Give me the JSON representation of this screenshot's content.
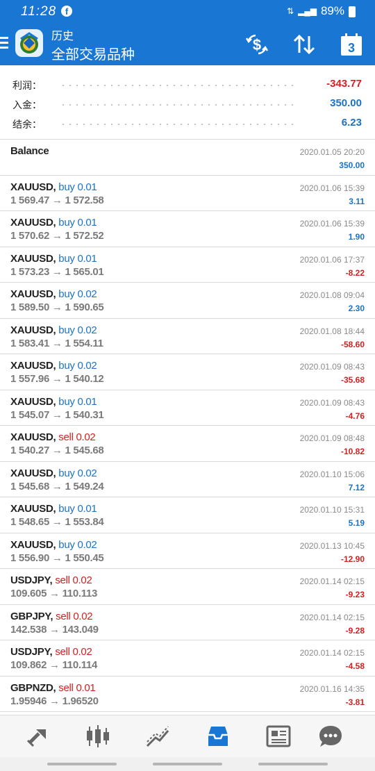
{
  "status_bar": {
    "time": "11:28",
    "battery": "89%",
    "network": "4G"
  },
  "app_bar": {
    "title_small": "历史",
    "title_large": "全部交易品种",
    "calendar_day": "3",
    "icons": [
      "menu-icon",
      "app-logo",
      "currency-exchange-icon",
      "sort-icon",
      "calendar-icon"
    ]
  },
  "summary": [
    {
      "label": "利润：",
      "value": "-343.77",
      "sign": "negative"
    },
    {
      "label": "入金：",
      "value": "350.00",
      "sign": "positive"
    },
    {
      "label": "结余：",
      "value": "6.23",
      "sign": "positive"
    }
  ],
  "deals": [
    {
      "symbol": "Balance",
      "side": "",
      "volume": "",
      "open_price": "",
      "close_price": "",
      "time": "2020.01.05 20:20",
      "profit": "350.00",
      "sign": "positive"
    },
    {
      "symbol": "XAUUSD,",
      "side": "buy",
      "volume": "0.01",
      "open_price": "1 569.47",
      "close_price": "1 572.58",
      "time": "2020.01.06 15:39",
      "profit": "3.11",
      "sign": "positive"
    },
    {
      "symbol": "XAUUSD,",
      "side": "buy",
      "volume": "0.01",
      "open_price": "1 570.62",
      "close_price": "1 572.52",
      "time": "2020.01.06 15:39",
      "profit": "1.90",
      "sign": "positive"
    },
    {
      "symbol": "XAUUSD,",
      "side": "buy",
      "volume": "0.01",
      "open_price": "1 573.23",
      "close_price": "1 565.01",
      "time": "2020.01.06 17:37",
      "profit": "-8.22",
      "sign": "negative"
    },
    {
      "symbol": "XAUUSD,",
      "side": "buy",
      "volume": "0.02",
      "open_price": "1 589.50",
      "close_price": "1 590.65",
      "time": "2020.01.08 09:04",
      "profit": "2.30",
      "sign": "positive"
    },
    {
      "symbol": "XAUUSD,",
      "side": "buy",
      "volume": "0.02",
      "open_price": "1 583.41",
      "close_price": "1 554.11",
      "time": "2020.01.08 18:44",
      "profit": "-58.60",
      "sign": "negative"
    },
    {
      "symbol": "XAUUSD,",
      "side": "buy",
      "volume": "0.02",
      "open_price": "1 557.96",
      "close_price": "1 540.12",
      "time": "2020.01.09 08:43",
      "profit": "-35.68",
      "sign": "negative"
    },
    {
      "symbol": "XAUUSD,",
      "side": "buy",
      "volume": "0.01",
      "open_price": "1 545.07",
      "close_price": "1 540.31",
      "time": "2020.01.09 08:43",
      "profit": "-4.76",
      "sign": "negative"
    },
    {
      "symbol": "XAUUSD,",
      "side": "sell",
      "volume": "0.02",
      "open_price": "1 540.27",
      "close_price": "1 545.68",
      "time": "2020.01.09 08:48",
      "profit": "-10.82",
      "sign": "negative"
    },
    {
      "symbol": "XAUUSD,",
      "side": "buy",
      "volume": "0.02",
      "open_price": "1 545.68",
      "close_price": "1 549.24",
      "time": "2020.01.10 15:06",
      "profit": "7.12",
      "sign": "positive"
    },
    {
      "symbol": "XAUUSD,",
      "side": "buy",
      "volume": "0.01",
      "open_price": "1 548.65",
      "close_price": "1 553.84",
      "time": "2020.01.10 15:31",
      "profit": "5.19",
      "sign": "positive"
    },
    {
      "symbol": "XAUUSD,",
      "side": "buy",
      "volume": "0.02",
      "open_price": "1 556.90",
      "close_price": "1 550.45",
      "time": "2020.01.13 10:45",
      "profit": "-12.90",
      "sign": "negative"
    },
    {
      "symbol": "USDJPY,",
      "side": "sell",
      "volume": "0.02",
      "open_price": "109.605",
      "close_price": "110.113",
      "time": "2020.01.14 02:15",
      "profit": "-9.23",
      "sign": "negative"
    },
    {
      "symbol": "GBPJPY,",
      "side": "sell",
      "volume": "0.02",
      "open_price": "142.538",
      "close_price": "143.049",
      "time": "2020.01.14 02:15",
      "profit": "-9.28",
      "sign": "negative"
    },
    {
      "symbol": "USDJPY,",
      "side": "sell",
      "volume": "0.02",
      "open_price": "109.862",
      "close_price": "110.114",
      "time": "2020.01.14 02:15",
      "profit": "-4.58",
      "sign": "negative"
    },
    {
      "symbol": "GBPNZD,",
      "side": "sell",
      "volume": "0.01",
      "open_price": "1.95946",
      "close_price": "1.96520",
      "time": "2020.01.16 14:35",
      "profit": "-3.81",
      "sign": "negative"
    }
  ],
  "arrow": "→",
  "bottom_nav": {
    "items": [
      "quotes-icon",
      "chart-icon",
      "trade-icon",
      "history-icon",
      "news-icon",
      "chat-icon"
    ],
    "active_index": 3
  },
  "colors": {
    "accent": "#1976d2",
    "positive": "#1a73c7",
    "negative": "#d32020"
  }
}
